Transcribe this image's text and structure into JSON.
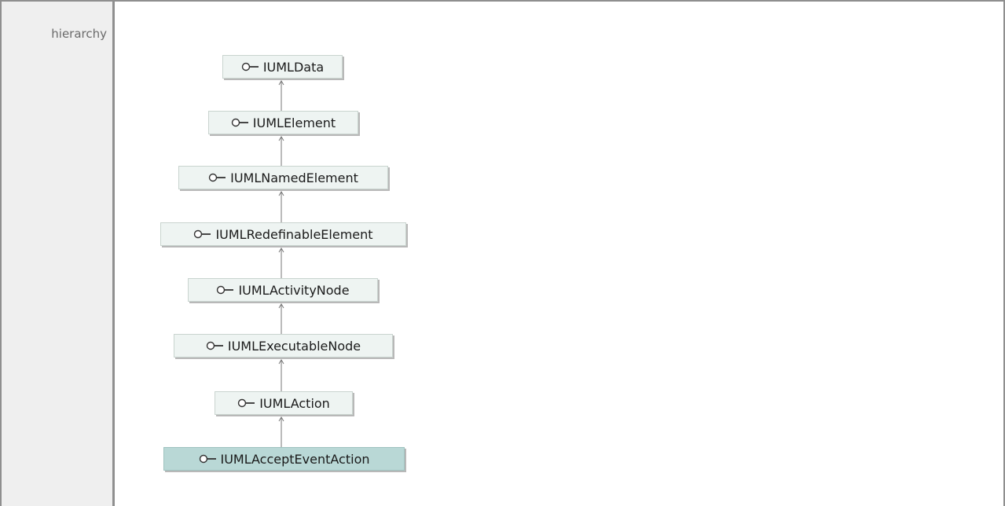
{
  "row_label": "hierarchy",
  "diagram": {
    "nodes": [
      {
        "name": "IUMLData",
        "icon": "interface-lollipop-icon"
      },
      {
        "name": "IUMLElement",
        "icon": "interface-lollipop-icon"
      },
      {
        "name": "IUMLNamedElement",
        "icon": "interface-lollipop-icon"
      },
      {
        "name": "IUMLRedefinableElement",
        "icon": "interface-lollipop-icon"
      },
      {
        "name": "IUMLActivityNode",
        "icon": "interface-lollipop-icon"
      },
      {
        "name": "IUMLExecutableNode",
        "icon": "interface-lollipop-icon"
      },
      {
        "name": "IUMLAction",
        "icon": "interface-lollipop-icon"
      },
      {
        "name": "IUMLAcceptEventAction",
        "icon": "interface-lollipop-icon",
        "current": true
      }
    ],
    "edge": "generalization arrow pointing to parent",
    "colors": {
      "node_fill": "#eef4f2",
      "current_node_fill": "#b9d8d6",
      "node_border": "#c9d4cf",
      "arrow": "#777777"
    }
  }
}
